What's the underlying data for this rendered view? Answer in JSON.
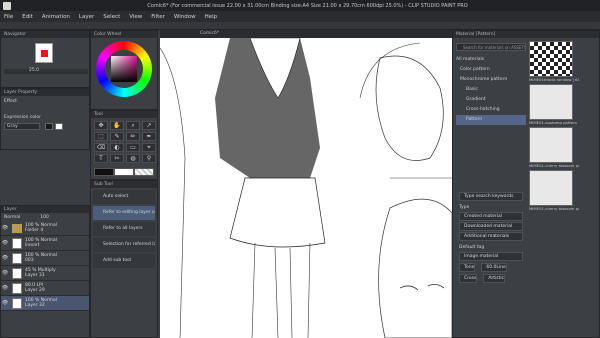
{
  "title": "Comic6* (For commercial issue 22.00 x 31.00cm Binding size:A4 Size 21.00 x 29.70cm 600dpi 25.0%) - CLIP STUDIO PAINT PRO",
  "menu": [
    "File",
    "Edit",
    "Animation",
    "Layer",
    "Select",
    "View",
    "Filter",
    "Window",
    "Help"
  ],
  "navigator": {
    "title": "Navigator",
    "zoom": "25.0"
  },
  "layer_property": {
    "title": "Layer Property",
    "effect": "Effect",
    "expression_label": "Expression color",
    "expression_value": "Gray"
  },
  "color_wheel": {
    "title": "Color Wheel"
  },
  "tool": {
    "title": "Tool",
    "icons": [
      "✥",
      "✋",
      "⌕",
      "↗",
      "⬚",
      "✎",
      "✏",
      "✒",
      "⌫",
      "◐",
      "▭",
      "⌖",
      "T",
      "✂",
      "◍",
      "⚲"
    ]
  },
  "subtool": {
    "title": "Sub Tool",
    "items": [
      "Auto select",
      "Refer to editing layer only",
      "Refer to all layers",
      "Selection for referred layers",
      "Add sub tool"
    ],
    "selected_index": 1
  },
  "layers": {
    "title": "Layer",
    "blend": "Normal",
    "opacity": "100",
    "rows": [
      {
        "mode": "100 % Normal",
        "name": "Folder 4",
        "type": "folder"
      },
      {
        "mode": "100 % Normal",
        "name": "lineart",
        "type": "layer"
      },
      {
        "mode": "100 % Normal",
        "name": "003",
        "type": "layer"
      },
      {
        "mode": "45 % Multiply",
        "name": "Layer 31",
        "type": "layer"
      },
      {
        "mode": "80.0 LPI",
        "name": "Layer 29",
        "type": "layer"
      },
      {
        "mode": "100 % Normal",
        "name": "Layer 32",
        "type": "layer",
        "selected": true
      }
    ]
  },
  "canvas_tab": "Comic6*",
  "material": {
    "title": "Material [Pattern]",
    "search_placeholder": "Search for materials on ASSETS",
    "tree": [
      {
        "label": "All materials",
        "selected": false
      },
      {
        "label": "Color pattern",
        "selected": false
      },
      {
        "label": "Monochrome pattern",
        "selected": false
      },
      {
        "label": "Basic",
        "selected": false
      },
      {
        "label": "Gradient",
        "selected": false
      },
      {
        "label": "Cross-hatching",
        "selected": false
      },
      {
        "label": "Pattern",
        "selected": true
      }
    ],
    "type_search_placeholder": "Type search keywords",
    "type_label": "Type",
    "type_buttons": [
      "Created material",
      "Downloaded material",
      "Additional materials"
    ],
    "default_tag_label": "Default tag",
    "tag_buttons": [
      "Image material",
      "Tone",
      "60.0Line",
      "Cross",
      "Artistic"
    ],
    "thumb_labels": [
      "MIME01triodic window | 61.0",
      "MIME01-austomp pattern",
      "MIME01-cherry blossom pattern",
      "MIME01-cherry blossom pattern"
    ]
  }
}
